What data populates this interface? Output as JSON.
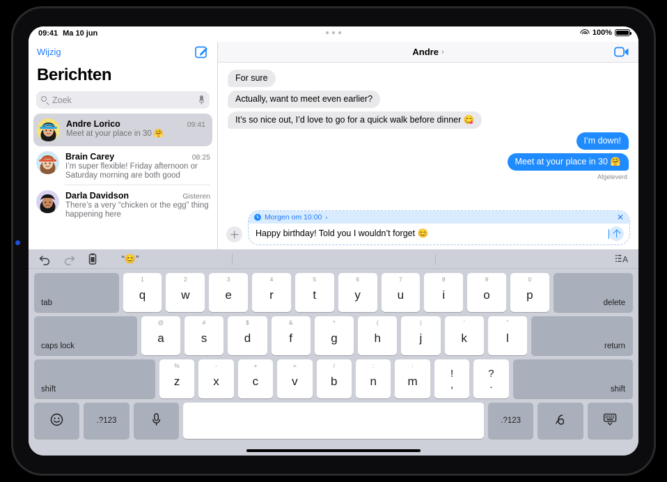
{
  "status_bar": {
    "time": "09:41",
    "date": "Ma 10 jun",
    "battery_percent": "100%",
    "wifi_icon": "wifi-icon",
    "battery_icon": "battery-icon",
    "multitask_handle": "multitask-dots"
  },
  "sidebar": {
    "edit_label": "Wijzig",
    "compose_icon": "compose-icon",
    "title": "Berichten",
    "search": {
      "placeholder": "Zoek",
      "search_icon": "search-icon",
      "dictation_icon": "microphone-icon"
    },
    "conversations": [
      {
        "name": "Andre Lorico",
        "time": "09:41",
        "preview": "Meet at your place in 30 🤗",
        "avatar_color": "#f6e27a",
        "selected": true
      },
      {
        "name": "Brain Carey",
        "time": "08:25",
        "preview": "I’m super flexible! Friday afternoon or Saturday morning are both good",
        "avatar_color": "#cfe8f5",
        "selected": false
      },
      {
        "name": "Darla Davidson",
        "time": "Gisteren",
        "preview": "There’s a very “chicken or the egg” thing happening here",
        "avatar_color": "#d8d2f0",
        "selected": false
      }
    ]
  },
  "chat": {
    "title": "Andre",
    "title_chevron": "›",
    "facetime_icon": "video-camera-icon",
    "messages": [
      {
        "text": "For sure",
        "direction": "in"
      },
      {
        "text": "Actually, want to meet even earlier?",
        "direction": "in"
      },
      {
        "text": "It’s so nice out, I’d love to go for a quick walk before dinner 😋",
        "direction": "in"
      },
      {
        "text": "I’m down!",
        "direction": "out"
      },
      {
        "text": "Meet at your place in 30 🤗",
        "direction": "out"
      }
    ],
    "delivered_label": "Afgeleverd",
    "composer": {
      "add_icon": "plus-icon",
      "scheduled": {
        "clock_icon": "clock-icon",
        "label": "Morgen om 10:00",
        "chevron": "›",
        "close_label": "✕"
      },
      "input_value": "Happy birthday! Told you I wouldn’t forget 😊",
      "send_icon": "send-arrow-up-icon"
    }
  },
  "keyboard": {
    "toolbar": {
      "undo_icon": "undo-arrow-icon",
      "redo_icon": "redo-arrow-icon",
      "paste_icon": "clipboard-paste-icon",
      "suggestions": [
        "“😊”",
        "",
        ""
      ],
      "format_icon": "text-format-icon"
    },
    "rows": [
      {
        "keys": [
          {
            "main": "tab",
            "alt": "",
            "style": "dark",
            "align": "left",
            "flex": 2.0
          },
          {
            "main": "q",
            "alt": "1",
            "flex": 1
          },
          {
            "main": "w",
            "alt": "2",
            "flex": 1
          },
          {
            "main": "e",
            "alt": "3",
            "flex": 1
          },
          {
            "main": "r",
            "alt": "4",
            "flex": 1
          },
          {
            "main": "t",
            "alt": "5",
            "flex": 1
          },
          {
            "main": "y",
            "alt": "6",
            "flex": 1
          },
          {
            "main": "u",
            "alt": "7",
            "flex": 1
          },
          {
            "main": "i",
            "alt": "8",
            "flex": 1
          },
          {
            "main": "o",
            "alt": "9",
            "flex": 1
          },
          {
            "main": "p",
            "alt": "0",
            "flex": 1
          },
          {
            "main": "delete",
            "alt": "",
            "style": "dark",
            "align": "right",
            "flex": 1.85
          }
        ]
      },
      {
        "keys": [
          {
            "main": "caps lock",
            "alt": "",
            "style": "dark",
            "align": "left",
            "flex": 2.45
          },
          {
            "main": "a",
            "alt": "@",
            "flex": 1
          },
          {
            "main": "s",
            "alt": "#",
            "flex": 1
          },
          {
            "main": "d",
            "alt": "$",
            "flex": 1
          },
          {
            "main": "f",
            "alt": "&",
            "flex": 1
          },
          {
            "main": "g",
            "alt": "*",
            "flex": 1
          },
          {
            "main": "h",
            "alt": "(",
            "flex": 1
          },
          {
            "main": "j",
            "alt": ")",
            "flex": 1
          },
          {
            "main": "k",
            "alt": "’",
            "flex": 1
          },
          {
            "main": "l",
            "alt": "”",
            "flex": 1
          },
          {
            "main": "return",
            "alt": "",
            "style": "dark",
            "align": "right",
            "flex": 2.4
          }
        ]
      },
      {
        "keys": [
          {
            "main": "shift",
            "alt": "",
            "style": "dark",
            "align": "left",
            "flex": 3.25
          },
          {
            "main": "z",
            "alt": "%",
            "flex": 1
          },
          {
            "main": "x",
            "alt": "-",
            "flex": 1
          },
          {
            "main": "c",
            "alt": "+",
            "flex": 1
          },
          {
            "main": "v",
            "alt": "=",
            "flex": 1
          },
          {
            "main": "b",
            "alt": "/",
            "flex": 1
          },
          {
            "main": "n",
            "alt": ";",
            "flex": 1
          },
          {
            "main": "m",
            "alt": ":",
            "flex": 1
          },
          {
            "top": "!",
            "bottom": ",",
            "style": "stacked",
            "flex": 1
          },
          {
            "top": "?",
            "bottom": ".",
            "style": "stacked",
            "flex": 1
          },
          {
            "main": "shift",
            "alt": "",
            "style": "dark",
            "align": "right",
            "flex": 3.2
          }
        ]
      },
      {
        "keys": [
          {
            "icon": "emoji-smiley-icon",
            "style": "dark",
            "flex": 1.15
          },
          {
            "main": ".?123",
            "style": "dark",
            "flex": 1.15
          },
          {
            "icon": "microphone-icon",
            "style": "dark",
            "flex": 1.15
          },
          {
            "main": "",
            "style": "space",
            "flex": 7.6
          },
          {
            "main": ".?123",
            "style": "dark",
            "flex": 1.15
          },
          {
            "icon": "handwriting-icon",
            "style": "dark",
            "flex": 1.15
          },
          {
            "icon": "hide-keyboard-icon",
            "style": "dark",
            "flex": 1.15
          }
        ]
      }
    ]
  }
}
